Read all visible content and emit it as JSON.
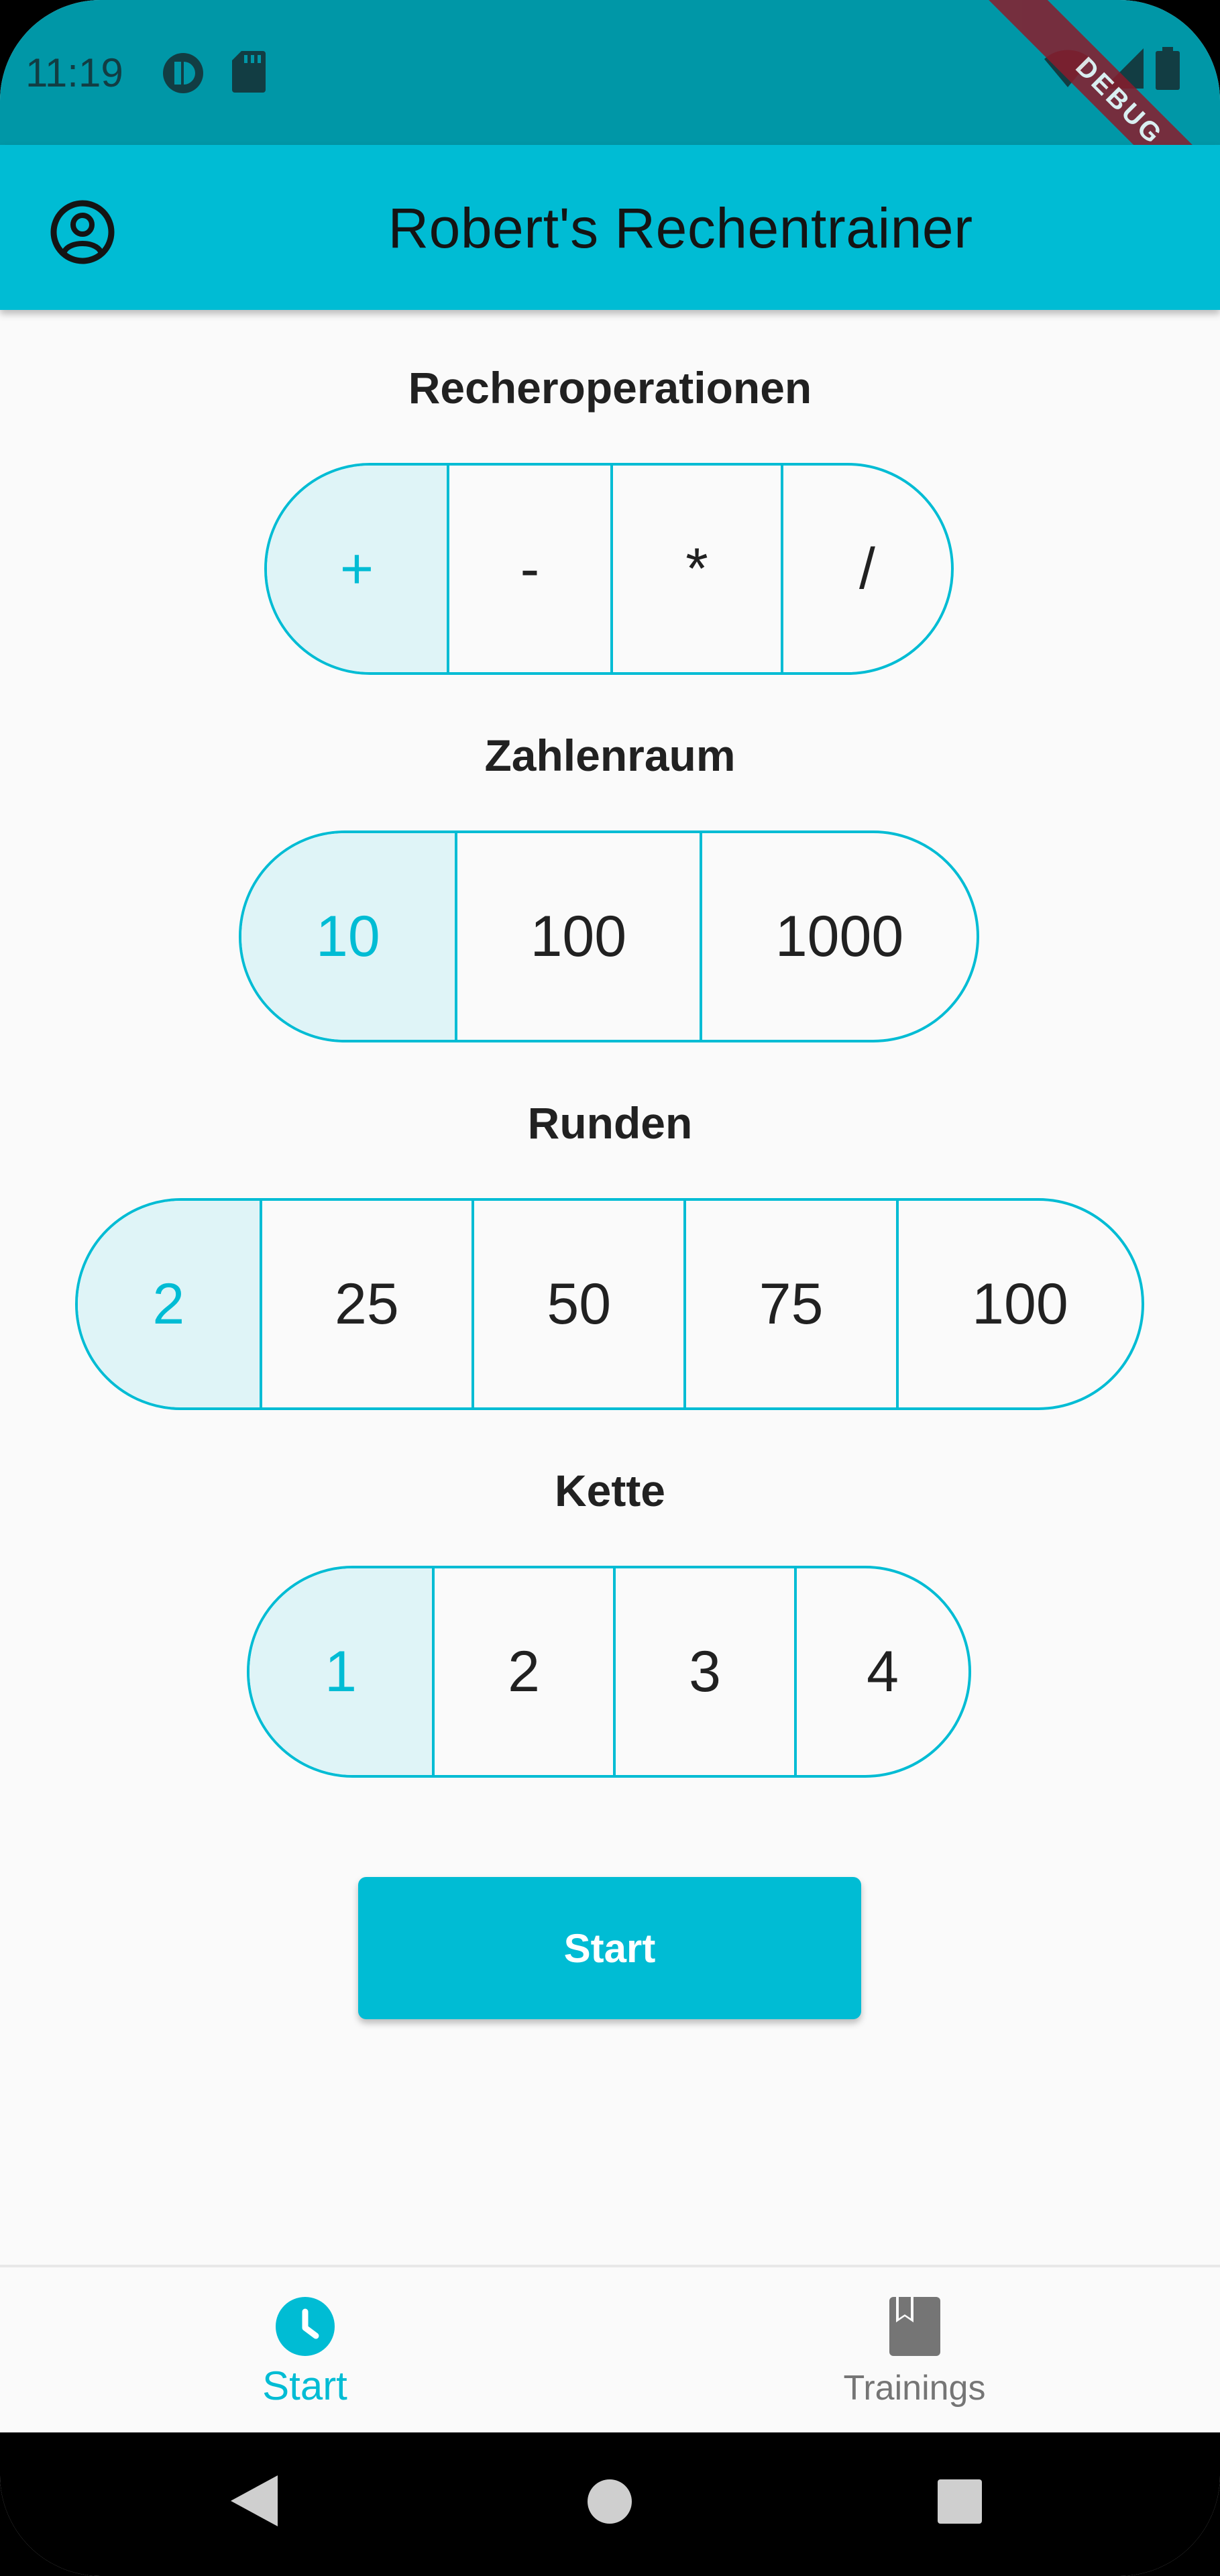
{
  "status_bar": {
    "time": "11:19",
    "icons": [
      "media-icon",
      "sd-card-icon",
      "wifi-icon",
      "signal-icon",
      "battery-icon"
    ]
  },
  "debug_banner": "DEBUG",
  "app_bar": {
    "title": "Robert's Rechentrainer",
    "leading_icon": "account-circle-icon"
  },
  "sections": {
    "operations": {
      "label": "Recheroperationen",
      "options": [
        "+",
        "-",
        "*",
        "/"
      ],
      "selected": "+"
    },
    "number_range": {
      "label": "Zahlenraum",
      "options": [
        "10",
        "100",
        "1000"
      ],
      "selected": "10"
    },
    "rounds": {
      "label": "Runden",
      "options": [
        "2",
        "25",
        "50",
        "75",
        "100"
      ],
      "selected": "2"
    },
    "chain": {
      "label": "Kette",
      "options": [
        "1",
        "2",
        "3",
        "4"
      ],
      "selected": "1"
    }
  },
  "start_button": {
    "label": "Start"
  },
  "bottom_nav": {
    "items": [
      {
        "label": "Start",
        "icon": "clock-icon",
        "active": true
      },
      {
        "label": "Trainings",
        "icon": "book-icon",
        "active": false
      }
    ]
  },
  "colors": {
    "primary": "#00bcd4",
    "status_bar": "#0097a7",
    "selected_fill": "#dff4f7",
    "background": "#fafafa",
    "text": "#212121",
    "inactive_nav": "#757575"
  }
}
